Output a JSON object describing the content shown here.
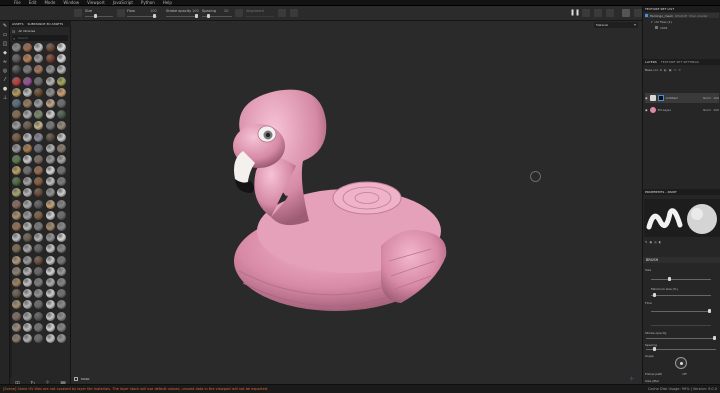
{
  "menu": {
    "items": [
      "File",
      "Edit",
      "Mode",
      "Window",
      "Viewport",
      "JavaScript",
      "Python",
      "Help"
    ]
  },
  "toolbar": {
    "size_label": "Size",
    "flow_label": "Flow",
    "flow_value": "100",
    "stroke_opacity_label": "Stroke opacity",
    "stroke_opacity_value": "100",
    "spacing_label": "Spacing",
    "spacing_value": "20",
    "alignment_label": "Alignment"
  },
  "assets_panel": {
    "tabs": [
      "ASSETS",
      "SUBSTANCE 3D ASSETS"
    ],
    "filter_label": "All libraries",
    "search_placeholder": "Search",
    "sphere_colors": [
      "#8a8a8a",
      "#a06a4a",
      "#c5c5c5",
      "#6b4a36",
      "#e2e2e2",
      "#5a5a5a",
      "#b87c52",
      "#9c9c9c",
      "#7a3c2a",
      "#d9d9d9",
      "#4a4a4a",
      "#7a7a7a",
      "#a57658",
      "#8e8e8e",
      "#bcbcbc",
      "#c23a3a",
      "#9a4f9a",
      "#6a6a6a",
      "#b7b7b7",
      "#a9a95a",
      "#b89a5a",
      "#c0c0c0",
      "#6a4a2a",
      "#8f8f8f",
      "#d0a070",
      "#5a6a7a",
      "#9a7a5a",
      "#a2a2a2",
      "#c4a888",
      "#6c6c6c",
      "#8a6a4a",
      "#b0b0b0",
      "#7a8a6a",
      "#d4d4d4",
      "#4a5a4a",
      "#a0a0a0",
      "#6a5a4a",
      "#c8b48a",
      "#787878",
      "#9a8a7a",
      "#7a5a3a",
      "#bdbdbd",
      "#8a8a9a",
      "#5a4a3a",
      "#cccccc",
      "#9a9a9a",
      "#a87a4a",
      "#6a6a7a",
      "#b4b4b4",
      "#8a7a6a",
      "#5a7a4a",
      "#c9c9c9",
      "#7a6a5a",
      "#999999",
      "#a8a8a8",
      "#bfa060",
      "#6e6e6e",
      "#9c6c4c",
      "#d8d8d8",
      "#707070",
      "#4a6a3a",
      "#a4a4a4",
      "#8c5a3a",
      "#c2c2c2",
      "#7c7c7c",
      "#a8a870",
      "#b8b8b8",
      "#6a4a3a",
      "#929292",
      "#cfcfcf",
      "#8a6a5a",
      "#adadad",
      "#5c5c5c",
      "#c6a476",
      "#858585",
      "#b0906a",
      "#9e9e9e",
      "#7e5e3e",
      "#d2d2d2",
      "#6a6a6a",
      "#9a7050",
      "#bababa",
      "#7a7a7a",
      "#a68a6a",
      "#8a8a8a",
      "#c0c0c0",
      "#6e5e4e",
      "#b2b2b2",
      "#949494",
      "#dadada",
      "#7a6a4a",
      "#a6a6a6",
      "#5e5e5e",
      "#c8c8c8",
      "#888888",
      "#b49878",
      "#9a9a9a",
      "#6c4c3c",
      "#cacaca",
      "#767676",
      "#8e7e6e",
      "#b6b6b6",
      "#646464",
      "#d6d6d6",
      "#9c9c9c",
      "#a08060",
      "#c4c4c4",
      "#7e7e7e",
      "#aeaeae",
      "#868686",
      "#6a5a4a",
      "#bcbcbc",
      "#949494",
      "#d0d0d0",
      "#707070",
      "#a89070",
      "#b8b8b8",
      "#686868",
      "#cecece",
      "#8c8c8c",
      "#7c6c5c",
      "#aaaaaa",
      "#5a5a5a",
      "#c6c6c6",
      "#909090",
      "#9e8e7e",
      "#bebebe",
      "#727272",
      "#d4d4d4",
      "#848484",
      "#8a7a6a",
      "#b0b0b0",
      "#666666",
      "#cacaca",
      "#969696"
    ]
  },
  "viewport": {
    "material_dropdown": "Material",
    "bottom_label": "MASK"
  },
  "status": {
    "message": "[Scene] Some UV tiles are not covered by layer tile materials. The layer stack will use default values; unused data in the viewport will not be exported.",
    "right": "Cache Disk Usage: 99% | Version: 9.0.0"
  },
  "texture_set_list": {
    "title": "TEXTURE SET LIST",
    "row1_name": "flamingo_mesh",
    "row1_shader": "OPAQUE",
    "row1_tag": "Main shader",
    "row2_name": "UV Tiles (1)",
    "row3_name": "1001"
  },
  "layers": {
    "tabs": [
      "LAYERS",
      "TEXTURE SET SETTINGS"
    ],
    "blend_mode": "Base col",
    "items": [
      {
        "name": "Untitled",
        "mode": "Norm",
        "opacity": "100",
        "color": "#d8d8d8"
      },
      {
        "name": "Fill Layer",
        "mode": "Norm",
        "opacity": "100",
        "color": "#d88aa8"
      }
    ]
  },
  "properties": {
    "title": "PROPERTIES - PAINT",
    "section_brush": "BRUSH",
    "size_label": "Size",
    "minimum_size_label": "Minimum size (%)",
    "flow_label": "Flow",
    "stroke_opacity_label": "Stroke opacity",
    "spacing_label": "Spacing",
    "angle_label": "Angle",
    "follow_path_label": "Follow path",
    "follow_path_value": "Off",
    "size_jitter_label": "Size jitter"
  },
  "colors": {
    "accent": "#4a8fdc",
    "flamingo": "#d38aa6",
    "status_warning": "#e06b2e"
  }
}
